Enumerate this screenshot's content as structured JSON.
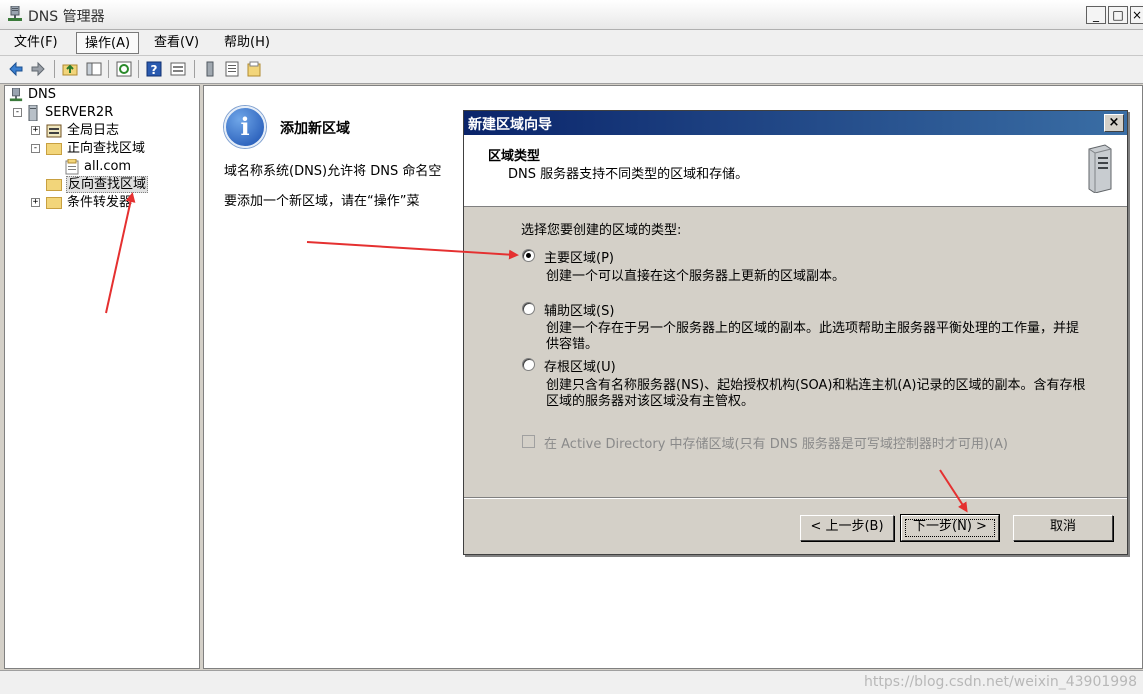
{
  "window": {
    "title": "DNS 管理器",
    "controls": [
      "_",
      "□",
      "×"
    ]
  },
  "menu": [
    {
      "label": "文件(F)"
    },
    {
      "label": "操作(A)"
    },
    {
      "label": "查看(V)"
    },
    {
      "label": "帮助(H)"
    }
  ],
  "tree": {
    "root": "DNS",
    "server": "SERVER2R",
    "items": [
      {
        "label": "全局日志"
      },
      {
        "label": "正向查找区域"
      },
      {
        "label": "all.com"
      },
      {
        "label": "反向查找区域"
      },
      {
        "label": "条件转发器"
      }
    ]
  },
  "content": {
    "heading": "添加新区域",
    "para1": "域名称系统(DNS)允许将 DNS 命名空",
    "para2": "要添加一个新区域，请在“操作”菜"
  },
  "dialog": {
    "title": "新建区域向导",
    "close": "×",
    "header_title": "区域类型",
    "header_sub": "DNS 服务器支持不同类型的区域和存储。",
    "prompt": "选择您要创建的区域的类型:",
    "options": [
      {
        "label": "主要区域(P)",
        "desc": "创建一个可以直接在这个服务器上更新的区域副本。",
        "checked": true
      },
      {
        "label": "辅助区域(S)",
        "desc": "创建一个存在于另一个服务器上的区域的副本。此选项帮助主服务器平衡处理的工作量，并提供容错。",
        "checked": false
      },
      {
        "label": "存根区域(U)",
        "desc": "创建只含有名称服务器(NS)、起始授权机构(SOA)和粘连主机(A)记录的区域的副本。含有存根区域的服务器对该区域没有主管权。",
        "checked": false
      }
    ],
    "ad_checkbox": "在 Active Directory 中存储区域(只有 DNS 服务器是可写域控制器时才可用)(A)",
    "buttons": {
      "back": "< 上一步(B)",
      "next": "下一步(N) >",
      "cancel": "取消"
    }
  },
  "statusbar": {
    "watermark": "https://blog.csdn.net/weixin_43901998"
  },
  "colors": {
    "annotation_arrow": "#e53030",
    "dialog_title": "#0a246a"
  }
}
